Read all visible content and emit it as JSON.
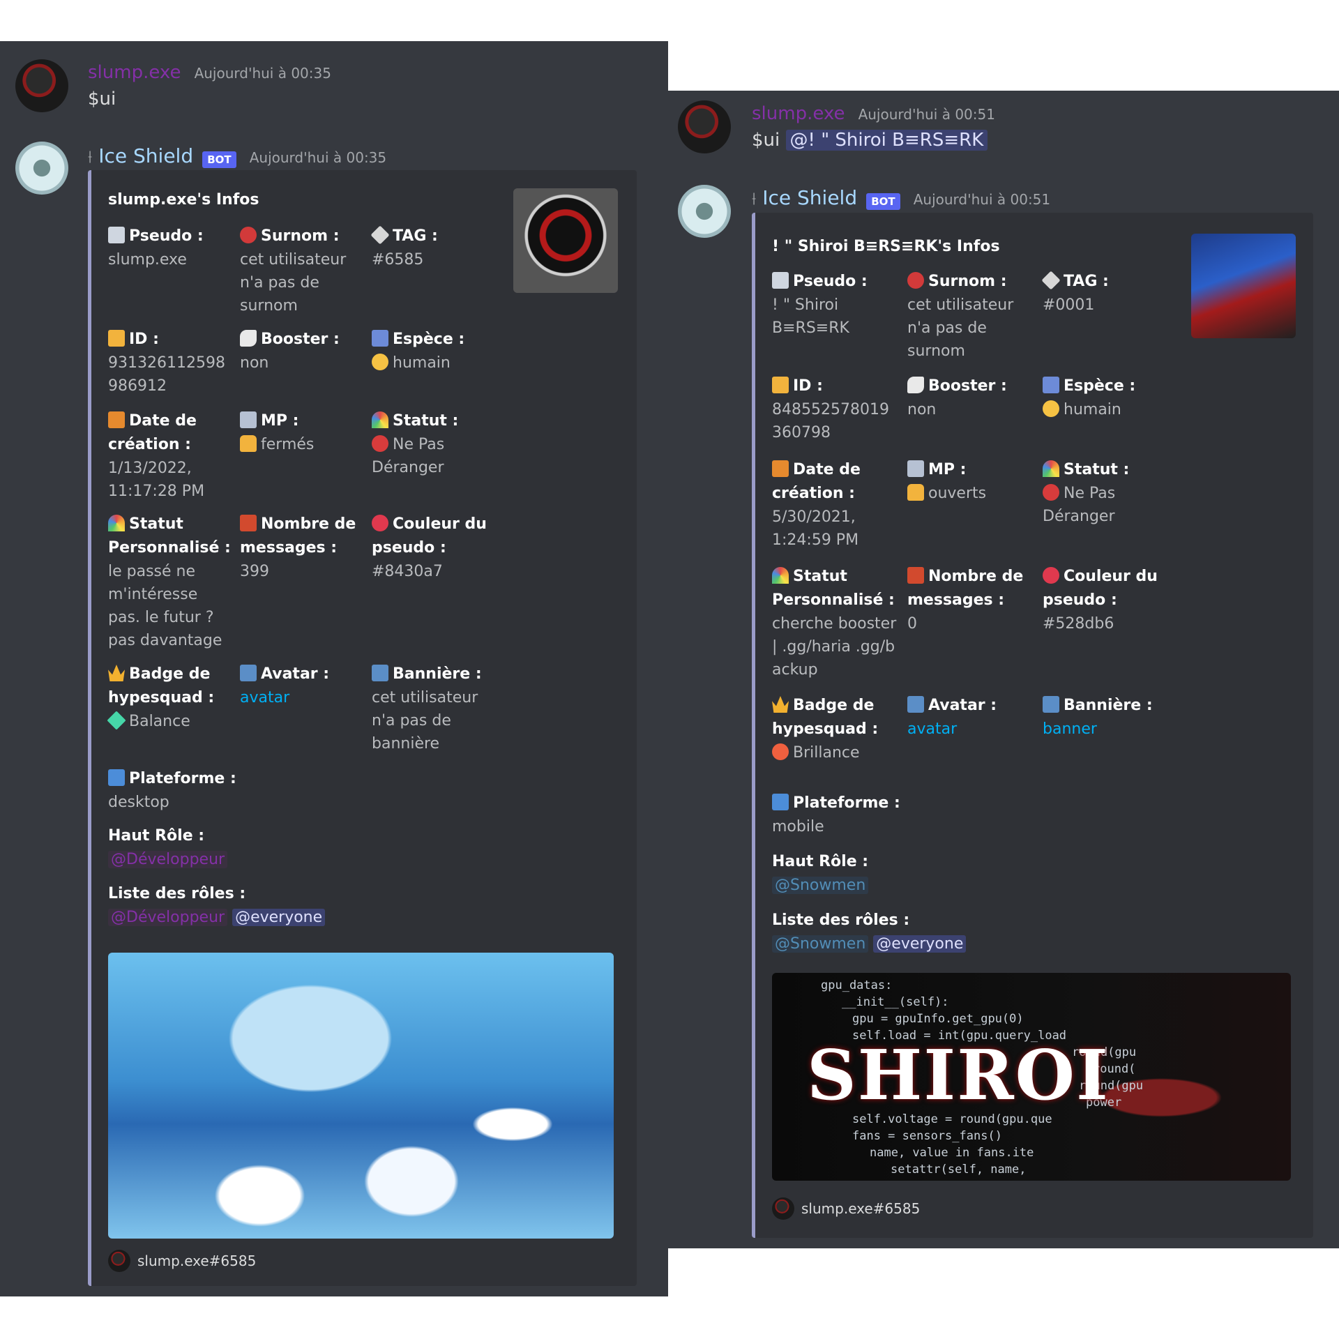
{
  "left": {
    "command": {
      "username": "slump.exe",
      "timestamp": "Aujourd'hui à 00:35",
      "text": "$ui"
    },
    "reply": {
      "bot_name": "Ice Shield",
      "bot_badge": "BOT",
      "timestamp": "Aujourd'hui à 00:35",
      "embed": {
        "title": "slump.exe's Infos",
        "fields": {
          "pseudo": {
            "name": "Pseudo :",
            "value": "slump.exe"
          },
          "surnom": {
            "name": "Surnom :",
            "value": "cet utilisateur n'a pas de surnom"
          },
          "tag": {
            "name": "TAG :",
            "value": "#6585"
          },
          "id": {
            "name": "ID :",
            "value": "931326112598986912"
          },
          "booster": {
            "name": "Booster :",
            "value": "non"
          },
          "espece": {
            "name": "Espèce :",
            "value": "humain"
          },
          "date": {
            "name": "Date de création :",
            "value": "1/13/2022, 11:17:28 PM"
          },
          "mp": {
            "name": "MP :",
            "value": "fermés"
          },
          "statut": {
            "name": "Statut :",
            "value": "Ne Pas Déranger"
          },
          "statut_perso": {
            "name": "Statut Personnalisé :",
            "value": "le passé ne m'intéresse pas. le futur ? pas davantage"
          },
          "nb_messages": {
            "name": "Nombre de messages :",
            "value": "399"
          },
          "couleur": {
            "name": "Couleur du pseudo :",
            "value": "#8430a7"
          },
          "badge": {
            "name": "Badge de hypesquad :",
            "value": "Balance"
          },
          "avatar": {
            "name": "Avatar :",
            "value": "avatar"
          },
          "banniere": {
            "name": "Bannière :",
            "value": "cet utilisateur n'a pas de bannière"
          },
          "plateforme": {
            "name": "Plateforme :",
            "value": "desktop"
          },
          "haut_role": {
            "name": "Haut Rôle :",
            "value": "@Développeur"
          },
          "liste_roles": {
            "name": "Liste des rôles :",
            "role1": "@Développeur",
            "role2": "@everyone"
          }
        },
        "footer": "slump.exe#6585"
      }
    }
  },
  "right": {
    "command": {
      "username": "slump.exe",
      "timestamp": "Aujourd'hui à 00:51",
      "prefix": "$ui",
      "mention": "@! \" Shiroi B≡RS≡RK"
    },
    "reply": {
      "bot_name": "Ice Shield",
      "bot_badge": "BOT",
      "timestamp": "Aujourd'hui à 00:51",
      "embed": {
        "title": "! \" Shiroi B≡RS≡RK's Infos",
        "fields": {
          "pseudo": {
            "name": "Pseudo :",
            "value": "! \" Shiroi B≡RS≡RK"
          },
          "surnom": {
            "name": "Surnom :",
            "value": "cet utilisateur n'a pas de surnom"
          },
          "tag": {
            "name": "TAG :",
            "value": "#0001"
          },
          "id": {
            "name": "ID :",
            "value": "848552578019360798"
          },
          "booster": {
            "name": "Booster :",
            "value": "non"
          },
          "espece": {
            "name": "Espèce :",
            "value": "humain"
          },
          "date": {
            "name": "Date de création :",
            "value": "5/30/2021, 1:24:59 PM"
          },
          "mp": {
            "name": "MP :",
            "value": "ouverts"
          },
          "statut": {
            "name": "Statut :",
            "value": "Ne Pas Déranger"
          },
          "statut_perso": {
            "name": "Statut Personnalisé :",
            "value": "cherche booster | .gg/haria .gg/backup"
          },
          "nb_messages": {
            "name": "Nombre de messages :",
            "value": "0"
          },
          "couleur": {
            "name": "Couleur du pseudo :",
            "value": "#528db6"
          },
          "badge": {
            "name": "Badge de hypesquad :",
            "value": "Brillance"
          },
          "avatar": {
            "name": "Avatar :",
            "value": "avatar"
          },
          "banniere": {
            "name": "Bannière :",
            "value": "banner"
          },
          "plateforme": {
            "name": "Plateforme :",
            "value": "mobile"
          },
          "haut_role": {
            "name": "Haut Rôle :",
            "value": "@Snowmen"
          },
          "liste_roles": {
            "name": "Liste des rôles :",
            "role1": "@Snowmen",
            "role2": "@everyone"
          }
        },
        "banner_image": {
          "logo": "SHIROI",
          "code_lines": [
            "gpu_datas:",
            "__init__(self):",
            "gpu = gpuInfo.get_gpu(0)",
            "self.load = int(gpu.query_load",
            "round(gpu",
            "round(",
            "round(gpu",
            "power",
            "self.voltage = round(gpu.que",
            "fans = sensors_fans()",
            "name, value in fans.ite",
            "setattr(self, name,"
          ]
        },
        "footer": "slump.exe#6585"
      }
    }
  },
  "colors": {
    "background": "#36393f",
    "embed": "#2f3136",
    "embed_border": "#9a9cc9",
    "username_purple": "#8430a7",
    "bot_name": "#a8d8ff",
    "link": "#00b0f4",
    "bot_badge": "#5865f2"
  }
}
